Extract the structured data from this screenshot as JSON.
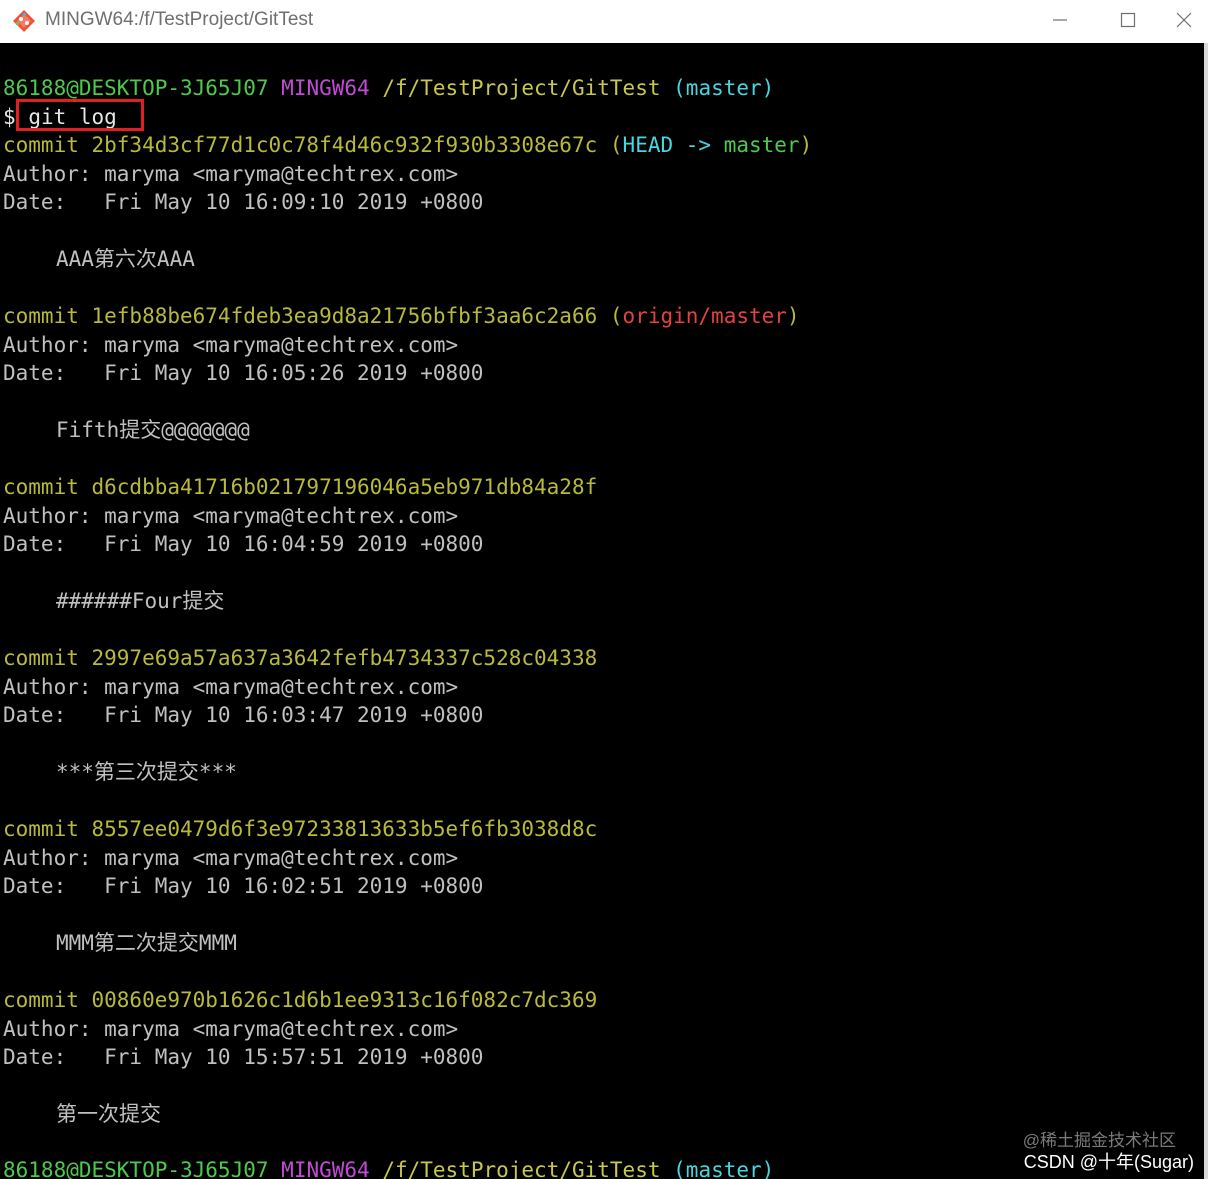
{
  "window": {
    "title": "MINGW64:/f/TestProject/GitTest",
    "app_icon": "git-bash-icon",
    "controls": [
      "minimize-icon",
      "maximize-icon",
      "close-icon"
    ]
  },
  "prompt": {
    "user_host": "86188@DESKTOP-3J65J07",
    "env": "MINGW64",
    "path": "/f/TestProject/GitTest",
    "branch": "(master)",
    "symbol": "$",
    "command": "git log"
  },
  "commits": [
    {
      "commit_label": "commit 2bf34d3cf77d1c0c78f4d46c932f930b3308e67c",
      "refs_open": "(",
      "ref_head": "HEAD -> ",
      "ref_branch": "master",
      "refs_close": ")",
      "author": "Author: maryma <maryma@techtrex.com>",
      "date": "Date:   Fri May 10 16:09:10 2019 +0800",
      "message": "AAA第六次AAA"
    },
    {
      "commit_label": "commit 1efb88be674fdeb3ea9d8a21756bfbf3aa6c2a66",
      "refs_open": "(",
      "ref_remote": "origin/master",
      "refs_close": ")",
      "author": "Author: maryma <maryma@techtrex.com>",
      "date": "Date:   Fri May 10 16:05:26 2019 +0800",
      "message": "Fifth提交@@@@@@@"
    },
    {
      "commit_label": "commit d6cdbba41716b021797196046a5eb971db84a28f",
      "author": "Author: maryma <maryma@techtrex.com>",
      "date": "Date:   Fri May 10 16:04:59 2019 +0800",
      "message": "######Four提交"
    },
    {
      "commit_label": "commit 2997e69a57a637a3642fefb4734337c528c04338",
      "author": "Author: maryma <maryma@techtrex.com>",
      "date": "Date:   Fri May 10 16:03:47 2019 +0800",
      "message": "***第三次提交***"
    },
    {
      "commit_label": "commit 8557ee0479d6f3e97233813633b5ef6fb3038d8c",
      "author": "Author: maryma <maryma@techtrex.com>",
      "date": "Date:   Fri May 10 16:02:51 2019 +0800",
      "message": "MMM第二次提交MMM"
    },
    {
      "commit_label": "commit 00860e970b1626c1d6b1ee9313c16f082c7dc369",
      "author": "Author: maryma <maryma@techtrex.com>",
      "date": "Date:   Fri May 10 15:57:51 2019 +0800",
      "message": "第一次提交"
    }
  ],
  "overlay": {
    "watermark": "@稀土掘金技术社区",
    "credit": "CSDN @十年(Sugar)"
  },
  "colors": {
    "highlight_box": "#e02020",
    "terminal_bg": "#000000"
  }
}
